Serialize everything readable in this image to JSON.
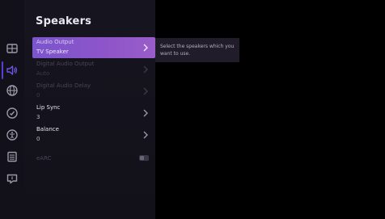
{
  "panel": {
    "title": "Speakers"
  },
  "sidebar": {
    "icons": [
      {
        "name": "input-source-icon"
      },
      {
        "name": "sound-icon",
        "active": true
      },
      {
        "name": "network-icon"
      },
      {
        "name": "privacy-icon"
      },
      {
        "name": "accessibility-icon"
      },
      {
        "name": "system-icon"
      },
      {
        "name": "support-icon"
      }
    ]
  },
  "menu": {
    "items": [
      {
        "label": "Audio Output",
        "value": "TV Speaker",
        "state": "selected",
        "control": "chevron"
      },
      {
        "label": "Digital Audio Output",
        "value": "Auto",
        "state": "disabled",
        "control": "chevron"
      },
      {
        "label": "Digital Audio Delay",
        "value": "0",
        "state": "disabled",
        "control": "chevron"
      },
      {
        "label": "Lip Sync",
        "value": "3",
        "state": "enabled",
        "control": "chevron"
      },
      {
        "label": "Balance",
        "value": "0",
        "state": "enabled",
        "control": "chevron"
      },
      {
        "label": "eARC",
        "value": "",
        "state": "disabled",
        "control": "toggle",
        "toggle_on": false
      }
    ]
  },
  "tooltip": {
    "text": "Select the speakers which you want to use."
  },
  "colors": {
    "accent": "#8a55c9",
    "rail_active": "#5a3fd6",
    "background": "#000000"
  }
}
